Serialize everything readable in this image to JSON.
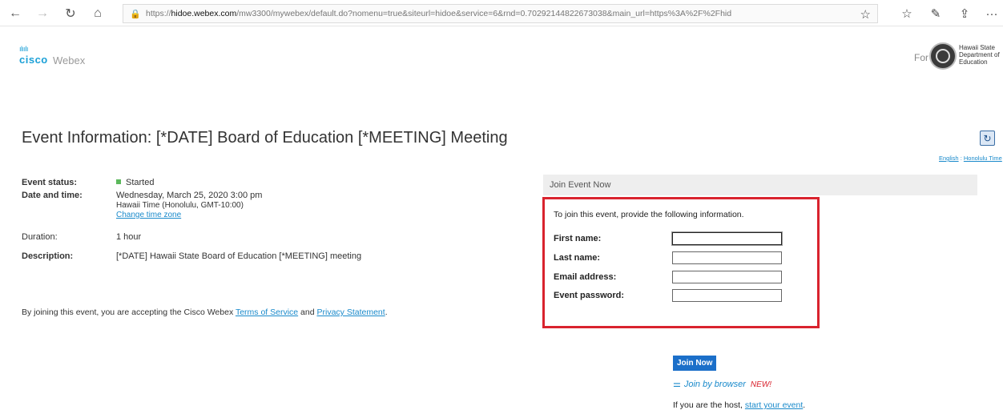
{
  "browser": {
    "url_prefix": "https://",
    "url_host": "hidoe.webex.com",
    "url_rest": "/mw3300/mywebex/default.do?nomenu=true&siteurl=hidoe&service=6&rnd=0.70292144822673038&main_url=https%3A%2F%2Fhid",
    "back_icon": "←",
    "forward_icon": "→",
    "refresh_icon": "↻",
    "home_icon": "⌂",
    "lock_icon": "🔒",
    "favorite_icon": "☆",
    "favorites_icon": "☆",
    "pen_icon": "✎",
    "share_icon": "⇪",
    "more_icon": "···"
  },
  "header": {
    "cisco_bars": "ılıılı",
    "cisco_label": "cisco",
    "webex_label": "Webex",
    "for_label": "For",
    "org_name": "Hawaii State Department of Education"
  },
  "title": "Event Information: [*DATE] Board of Education [*MEETING] Meeting",
  "refresh_glyph": "↻",
  "lang": {
    "language": "English",
    "separator": " : ",
    "timezone": "Honolulu Time"
  },
  "details": {
    "status_label": "Event status:",
    "status_value": "Started",
    "datetime_label": "Date and time:",
    "datetime_line1": "Wednesday, March 25, 2020 3:00 pm",
    "datetime_line2": "Hawaii Time (Honolulu, GMT-10:00)",
    "change_tz": "Change time zone",
    "duration_label": "Duration:",
    "duration_value": "1 hour",
    "description_label": "Description:",
    "description_value": "[*DATE] Hawaii State Board of Education [*MEETING] meeting"
  },
  "terms": {
    "prefix": "By joining this event, you are accepting the Cisco Webex ",
    "tos": "Terms of Service",
    "and": " and ",
    "privacy": "Privacy Statement",
    "suffix": "."
  },
  "join": {
    "header": "Join Event Now",
    "instructions": "To join this event, provide the following information.",
    "first_name_label": "First name:",
    "last_name_label": "Last name:",
    "email_label": "Email address:",
    "password_label": "Event password:",
    "first_name_value": "",
    "last_name_value": "",
    "email_value": "",
    "password_value": "",
    "join_button": "Join Now",
    "browser_icon": "⚌",
    "join_browser": "Join by browser",
    "new_badge": "NEW!",
    "host_prefix": "If you are the host, ",
    "host_link": "start your event",
    "host_suffix": "."
  },
  "colors": {
    "highlight_box": "#d9232e",
    "link": "#1a8acb",
    "join_button": "#1b6fc9",
    "status_started": "#5cb85c"
  }
}
